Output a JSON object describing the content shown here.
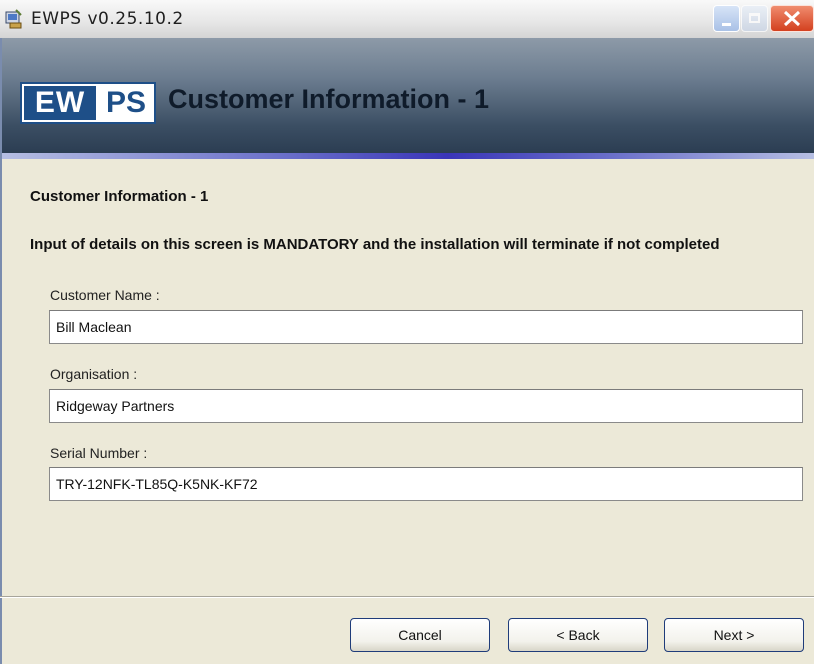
{
  "window": {
    "title": "EWPS v0.25.10.2",
    "controls": [
      "minimize",
      "maximize",
      "close"
    ]
  },
  "header": {
    "logo_left": "EW",
    "logo_right": "PS",
    "title": "Customer Information - 1"
  },
  "content": {
    "section_title": "Customer Information - 1",
    "mandatory_notice": "Input of details on this screen is MANDATORY and the installation will terminate if not completed",
    "fields": [
      {
        "label": "Customer Name :",
        "value": "Bill Maclean"
      },
      {
        "label": "Organisation :",
        "value": "Ridgeway Partners"
      },
      {
        "label": "Serial Number :",
        "value": "TRY-12NFK-TL85Q-K5NK-KF72"
      }
    ]
  },
  "footer": {
    "cancel_label": "Cancel",
    "back_label": "< Back",
    "next_label": "Next >"
  },
  "colors": {
    "accent": "#1e4f88",
    "dialog_bg": "#ece9d8",
    "close_button": "#d3401f"
  }
}
